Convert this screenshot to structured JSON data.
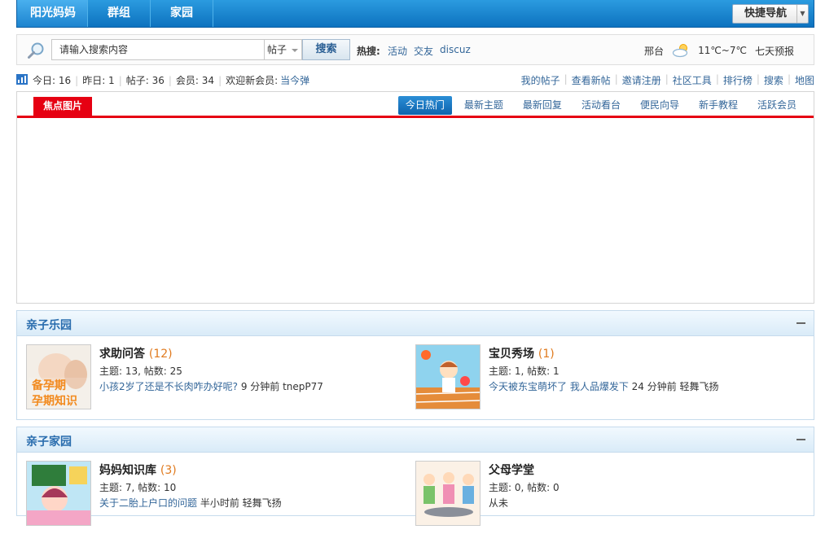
{
  "nav": {
    "tabs": [
      "阳光妈妈",
      "群组",
      "家园"
    ],
    "quick_label": "快捷导航"
  },
  "search": {
    "placeholder": "请输入搜索内容",
    "type": "帖子",
    "button": "搜索",
    "hot_label": "热搜:",
    "hot_links": [
      "活动",
      "交友",
      "discuz"
    ]
  },
  "weather": {
    "city": "邢台",
    "temp": "11℃~7℃",
    "forecast": "七天预报"
  },
  "stats": {
    "today": "今日: 16",
    "yesterday": "昨日: 1",
    "posts": "帖子: 36",
    "members": "会员: 34",
    "welcome": "欢迎新会员:",
    "newest": "当今弹"
  },
  "quicklinks": [
    "我的帖子",
    "查看新帖",
    "邀请注册",
    "社区工具",
    "排行榜",
    "搜索",
    "地图"
  ],
  "focus": {
    "label": "焦点图片",
    "tabs": [
      "今日热门",
      "最新主题",
      "最新回复",
      "活动看台",
      "便民向导",
      "新手教程",
      "活跃会员"
    ]
  },
  "groups": [
    {
      "title": "亲子乐园",
      "forums": [
        {
          "name": "求助问答",
          "count": "(12)",
          "stats": "主题: 13, 帖数: 25",
          "last_link": "小孩2岁了还是不长肉咋办好呢?",
          "last_meta": " 9 分钟前 tnepP77",
          "thumb_text_1": "备孕期",
          "thumb_text_2": "孕期知识"
        },
        {
          "name": "宝贝秀场",
          "count": "(1)",
          "stats": "主题: 1, 帖数: 1",
          "last_link": "今天被东宝萌坏了 我人品爆发下",
          "last_meta": " 24 分钟前 轻舞飞扬"
        }
      ]
    },
    {
      "title": "亲子家园",
      "forums": [
        {
          "name": "妈妈知识库",
          "count": "(3)",
          "stats": "主题: 7, 帖数: 10",
          "last_link": "关于二胎上户口的问题",
          "last_meta": " 半小时前 轻舞飞扬"
        },
        {
          "name": "父母学堂",
          "count": "",
          "stats": "主题: 0, 帖数: 0",
          "last_link": "",
          "last_meta": "从未"
        }
      ]
    }
  ],
  "colors": {
    "nav_blue": "#0d72bf",
    "focus_red": "#e60012",
    "link": "#336699",
    "count_orange": "#e07a1e"
  }
}
